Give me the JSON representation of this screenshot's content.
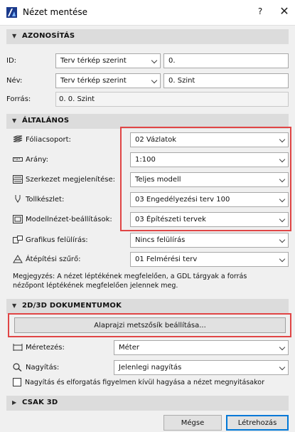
{
  "window": {
    "title": "Nézet mentése",
    "help": "?",
    "close": "✕"
  },
  "sections": {
    "identification": "AZONOSÍTÁS",
    "general": "ÁLTALÁNOS",
    "docs2d3d": "2D/3D DOKUMENTUMOK",
    "only3d": "CSAK 3D"
  },
  "identification": {
    "id_label": "ID:",
    "id_source": "Terv térkép szerint",
    "id_value": "0.",
    "name_label": "Név:",
    "name_source": "Terv térkép szerint",
    "name_value": "0. Szint",
    "source_label": "Forrás:",
    "source_value": "0. 0. Szint"
  },
  "general": {
    "layer_label": "Fóliacsoport:",
    "layer_value": "02 Vázlatok",
    "scale_label": "Arány:",
    "scale_value": "1:100",
    "structure_label": "Szerkezet megjelenítése:",
    "structure_value": "Teljes modell",
    "pen_label": "Tollkészlet:",
    "pen_value": "03 Engedélyezési terv 100",
    "mvo_label": "Modellnézet-beállítások:",
    "mvo_value": "03 Építészeti tervek",
    "override_label": "Grafikus felülírás:",
    "override_value": "Nincs felülírás",
    "renov_label": "Átépítési szűrő:",
    "renov_value": "01 Felmérési terv",
    "note_line1": "Megjegyzés: A nézet léptékének megfelelően, a GDL tárgyak a forrás",
    "note_line2": "nézőpont léptékének megfelelően jelennek meg."
  },
  "docs": {
    "cut_button": "Alaprajzi metszősík beállítása...",
    "dim_label": "Méretezés:",
    "dim_value": "Méter",
    "zoom_label": "Nagyítás:",
    "zoom_value": "Jelenlegi nagyítás",
    "ignore_label": "Nagyítás és elforgatás figyelmen kívül hagyása a nézet megnyitásakor"
  },
  "footer": {
    "cancel": "Mégse",
    "create": "Létrehozás"
  },
  "colors": {
    "highlight": "#e04545",
    "section_bg": "#dcdcdc",
    "dialog_bg": "#f0f0f0"
  }
}
